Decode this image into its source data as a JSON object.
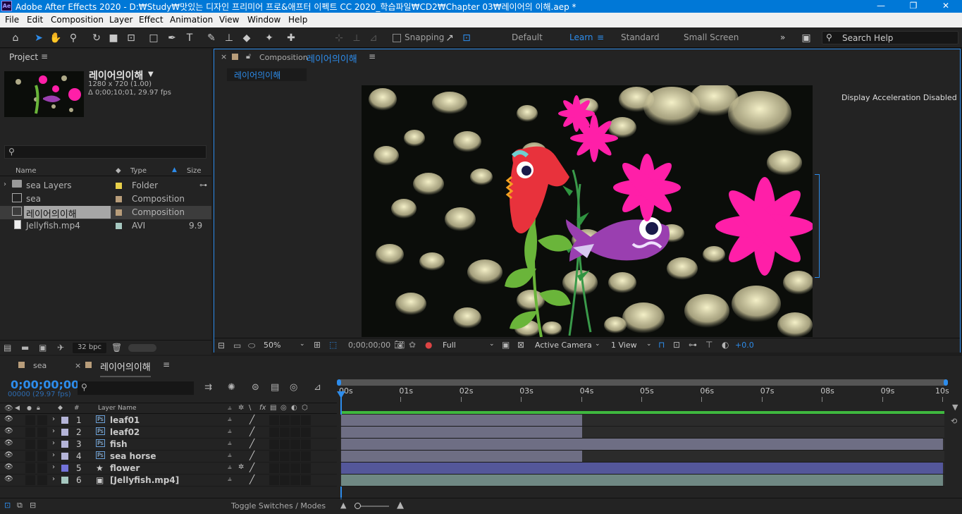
{
  "titlebar": {
    "app_icon": "Ae",
    "title": "Adobe After Effects 2020 - D:₩Study₩맛있는 디자인 프리미어 프로&애프터 이펙트 CC 2020_학습파일₩CD2₩Chapter 03₩레이어의 이해.aep *",
    "minimize": "—",
    "maximize": "❐",
    "close": "✕"
  },
  "menu": [
    "File",
    "Edit",
    "Composition",
    "Layer",
    "Effect",
    "Animation",
    "View",
    "Window",
    "Help"
  ],
  "toolbar": {
    "snapping_label": "Snapping",
    "workspaces": [
      "Default",
      "Learn",
      "Standard",
      "Small Screen"
    ],
    "active_workspace": "Learn",
    "more": "»",
    "search_placeholder": "Search Help"
  },
  "project": {
    "tab_label": "Project",
    "comp_name": "레이어의이해",
    "comp_res": "1280 x 720 (1.00)",
    "comp_duration": "Δ 0;00;10;01, 29.97 fps",
    "search_placeholder": "",
    "columns": {
      "name": "Name",
      "type": "Type",
      "size": "Size"
    },
    "items": [
      {
        "name": "sea Layers",
        "type": "Folder",
        "size": "",
        "label_color": "#e8d04a",
        "icon": "folder-icon"
      },
      {
        "name": "sea",
        "type": "Composition",
        "size": "",
        "label_color": "#b89d7a",
        "icon": "composition-icon"
      },
      {
        "name": "레이어의이해",
        "type": "Composition",
        "size": "",
        "label_color": "#b89d7a",
        "icon": "composition-icon",
        "selected": true
      },
      {
        "name": "Jellyfish.mp4",
        "type": "AVI",
        "size": "9.9",
        "label_color": "#a6c8c0",
        "icon": "video-icon"
      }
    ],
    "footer_bpc": "32 bpc"
  },
  "composition": {
    "tab_prefix": "Composition",
    "tab_name": "레이어의이해",
    "breadcrumb": "레이어의이해",
    "accel_note": "Display Acceleration Disabled",
    "bottom": {
      "zoom": "50%",
      "timecode": "0;00;00;00",
      "resolution": "Full",
      "camera": "Active Camera",
      "views": "1 View",
      "exposure": "+0.0"
    }
  },
  "timeline": {
    "tabs": [
      {
        "name": "sea",
        "color": "#b89d7a"
      },
      {
        "name": "레이어의이해",
        "color": "#b89d7a",
        "active": true
      }
    ],
    "timecode": "0;00;00;00",
    "frame_info": "00000 (29.97 fps)",
    "search_placeholder": "",
    "header": {
      "number": "#",
      "layer_name": "Layer Name"
    },
    "ruler": [
      "00s",
      "01s",
      "02s",
      "03s",
      "04s",
      "05s",
      "06s",
      "07s",
      "08s",
      "09s",
      "10s"
    ],
    "layers": [
      {
        "num": "1",
        "name": "leaf01",
        "label_color": "#b4b4d8",
        "icon": "photoshop-layer-icon",
        "bar_color": "#6e6e84",
        "bar_end_s": 4.0
      },
      {
        "num": "2",
        "name": "leaf02",
        "label_color": "#b4b4d8",
        "icon": "photoshop-layer-icon",
        "bar_color": "#6e6e84",
        "bar_end_s": 4.0
      },
      {
        "num": "3",
        "name": "fish",
        "label_color": "#b4b4d8",
        "icon": "photoshop-layer-icon",
        "bar_color": "#6e6e84",
        "bar_end_s": 10.0
      },
      {
        "num": "4",
        "name": "sea horse",
        "label_color": "#b4b4d8",
        "icon": "photoshop-layer-icon",
        "bar_color": "#6e6e84",
        "bar_end_s": 4.0
      },
      {
        "num": "5",
        "name": "flower",
        "label_color": "#7373d9",
        "icon": "shape-layer-icon",
        "bar_color": "#54579a",
        "bar_end_s": 10.0
      },
      {
        "num": "6",
        "name": "[Jellyfish.mp4]",
        "label_color": "#a6c8c0",
        "icon": "footage-layer-icon",
        "bar_color": "#6f8883",
        "bar_end_s": 10.0
      }
    ],
    "toggle_label": "Toggle Switches / Modes"
  }
}
